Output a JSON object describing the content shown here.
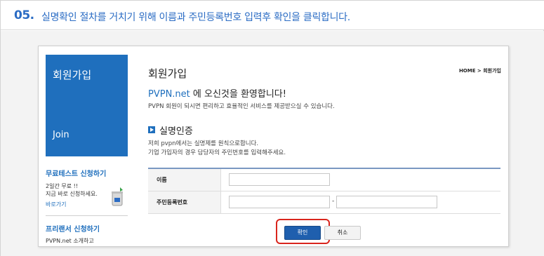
{
  "step": {
    "number": "05.",
    "instruction": "실명확인 절차를 거치기 위해 이름과 주민등록번호 입력후 확인을 클릭합니다."
  },
  "sidebar": {
    "banner_korean": "회원가입",
    "banner_english": "Join",
    "free_test": {
      "title": "무료테스트 신청하기",
      "line1": "2일간 무료 !!",
      "line2": "지금 바로 신청하세요.",
      "link": "바로가기"
    },
    "freelancer": {
      "title": "프리랜서 신청하기",
      "line1": "PVPN.net 소개하고"
    }
  },
  "main": {
    "title": "회원가입",
    "breadcrumb": "HOME > 회원가입",
    "welcome_brand": "PVPN.net",
    "welcome_rest": " 에 오신것을 환영합니다!",
    "welcome_sub": "PVPN 회원이 되시면 편리하고 효율적인 서비스를 제공받으실 수 있습니다.",
    "section_title": "실명인증",
    "section_desc1": "저희 pvpn에서는 실명제를 원칙으로합니다.",
    "section_desc2": "기업 가입자의 경우 담당자의 주민번호를 입력해주세요.",
    "form": {
      "name_label": "이름",
      "name_value": "",
      "ssn_label": "주민등록번호",
      "ssn_front": "",
      "ssn_back": "",
      "ssn_dash": "-"
    },
    "ok_label": "확인",
    "cancel_label": "취소"
  },
  "colors": {
    "accent": "#2b6cc4",
    "banner": "#1f6fbd",
    "highlight": "#d9251d"
  }
}
